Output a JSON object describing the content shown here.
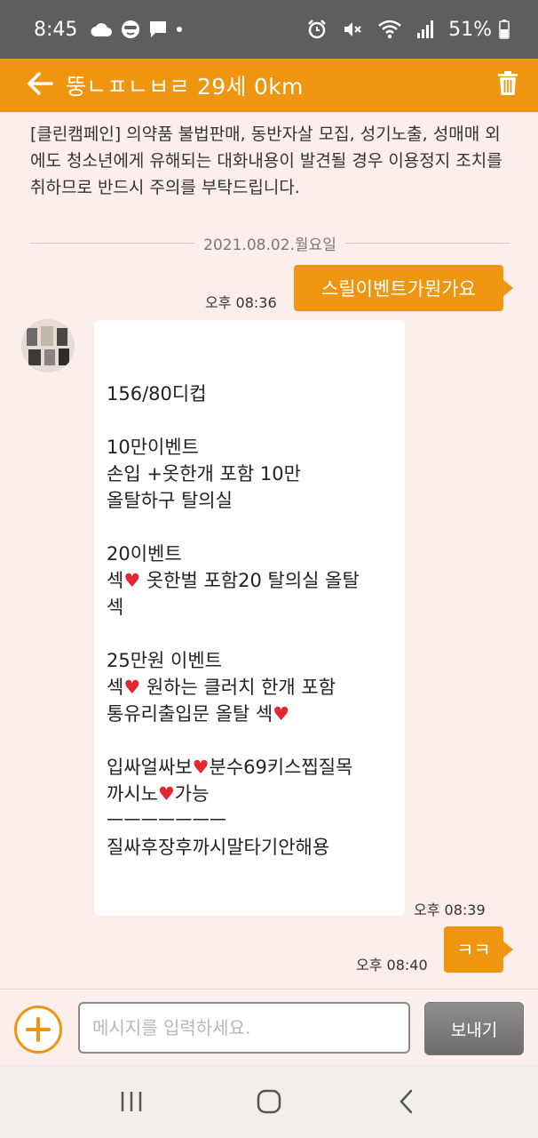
{
  "status_bar": {
    "time": "8:45",
    "battery": "51%",
    "left_icons": [
      "cloud-icon",
      "face-icon",
      "message-icon",
      "dot-icon"
    ],
    "right_icons": [
      "alarm-icon",
      "mute-icon",
      "wifi-icon",
      "signal-icon",
      "battery-icon"
    ]
  },
  "header": {
    "title": "뚱ㄴㅍㄴㅂㄹ 29세 0km",
    "back_icon": "arrow-left-icon",
    "delete_icon": "trash-icon"
  },
  "notice": {
    "text": "[클린캠페인] 의약품 불법판매, 동반자살 모집, 성기노출, 성매매 외에도 청소년에게 유해되는 대화내용이 발견될 경우 이용정지 조치를 취하므로 반드시 주의를 부탁드립니다."
  },
  "date_separator": "2021.08.02.월요일",
  "messages": {
    "out1": {
      "text": "스릴이벤트가뭔가요",
      "time": "오후 08:36"
    },
    "in1": {
      "time": "오후 08:39",
      "paragraphs": [
        [
          "156/80디컵"
        ],
        [
          "10만이벤트",
          "손입 +옷한개 포함 10만",
          "올탈하구 탈의실"
        ],
        [
          "20이벤트",
          "섹❤️ 옷한벌 포함20 탈의실 올탈",
          "섹"
        ],
        [
          "25만원 이벤트",
          "섹❤️ 원하는 클러치 한개 포함",
          "통유리출입문 올탈 섹❤️"
        ],
        [
          "입싸얼싸보❤️분수69키스찝질목",
          "까시노❤️가능",
          "ㅡㅡㅡㅡㅡㅡㅡ",
          "질싸후장후까시말타기안해용"
        ]
      ]
    },
    "out2": {
      "text": "ㅋㅋ",
      "time": "오후 08:40"
    }
  },
  "input_bar": {
    "placeholder": "메시지를 입력하세요.",
    "send_label": "보내기",
    "add_icon": "plus-icon"
  },
  "nav_bar": {
    "icons": [
      "recent-apps-icon",
      "home-icon",
      "back-icon"
    ]
  },
  "colors": {
    "accent": "#f0950f",
    "status_bar": "#5e5e5e",
    "chat_bg": "#fdeeee",
    "send_button": "#7b7b7b"
  }
}
